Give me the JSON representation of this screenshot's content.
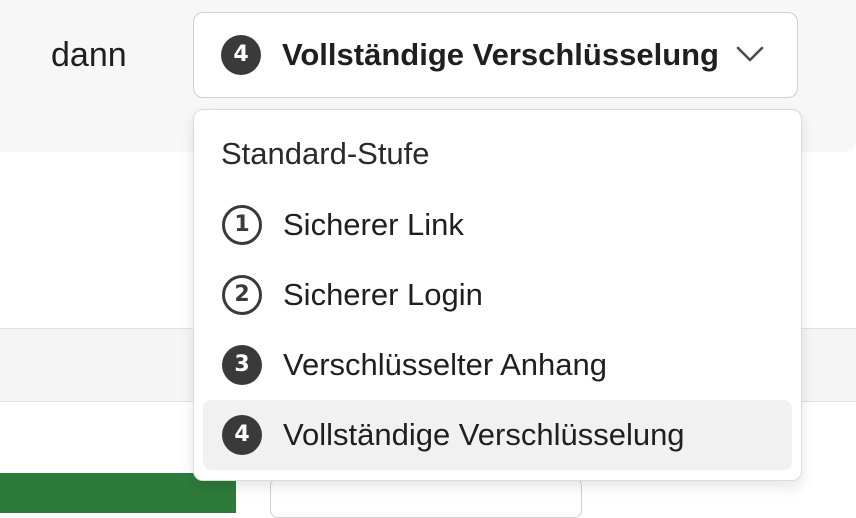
{
  "condition": {
    "label": "dann"
  },
  "select": {
    "value_number": "4",
    "value_label": "Vollständige Verschlüsselung"
  },
  "dropdown": {
    "header": "Standard-Stufe",
    "options": [
      {
        "number": "1",
        "label": "Sicherer Link",
        "icon_style": "outline",
        "selected": false
      },
      {
        "number": "2",
        "label": "Sicherer Login",
        "icon_style": "outline",
        "selected": false
      },
      {
        "number": "3",
        "label": "Verschlüsselter Anhang",
        "icon_style": "filled",
        "selected": false
      },
      {
        "number": "4",
        "label": "Vollständige Verschlüsselung",
        "icon_style": "filled",
        "selected": true
      }
    ]
  },
  "colors": {
    "icon_dark": "#3a3a3a",
    "selected_option_bg": "#f1f1f1",
    "green_button": "#2d7a3a"
  },
  "icons": {
    "chevron": "chevron-down-icon",
    "level": "circled-number-icon"
  }
}
